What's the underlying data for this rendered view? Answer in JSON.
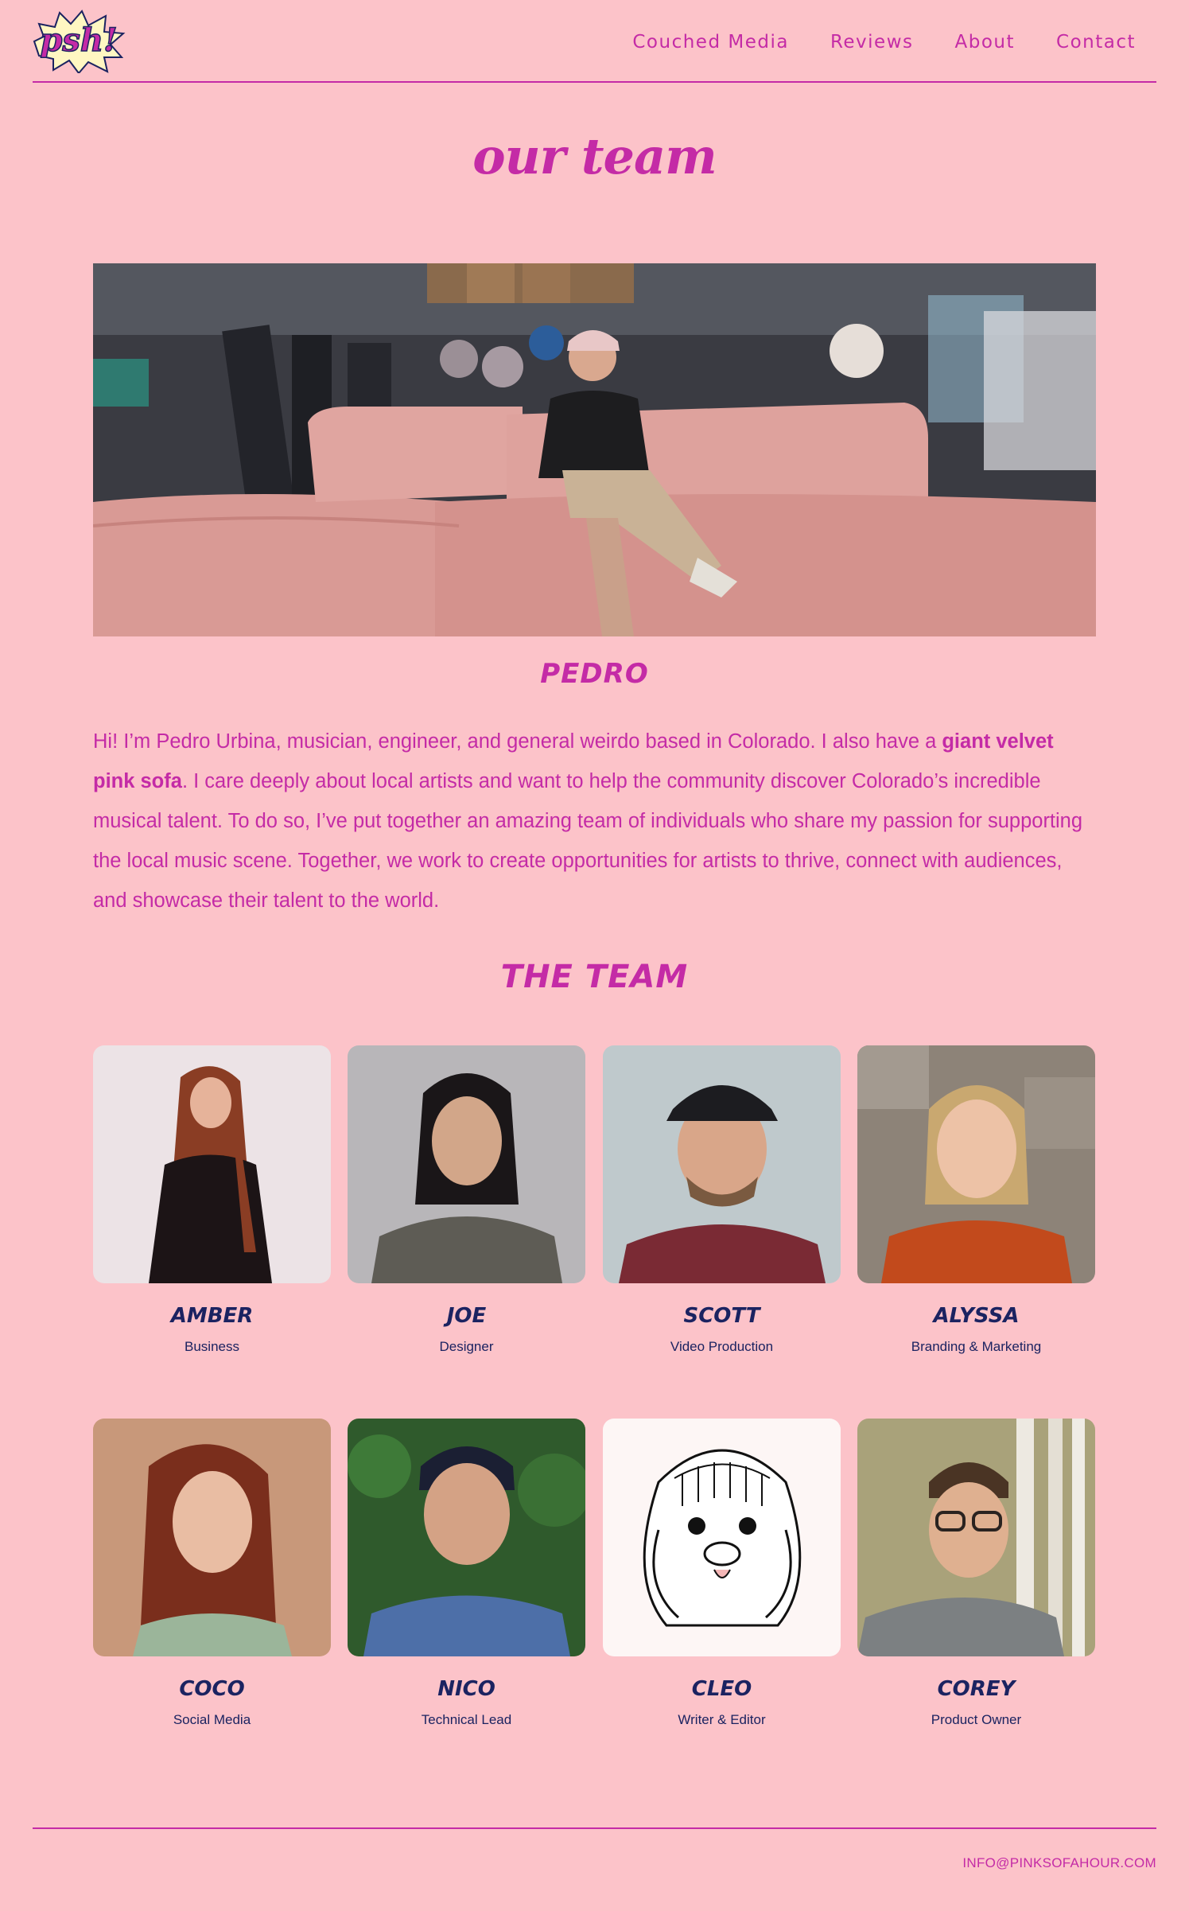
{
  "logo": {
    "text": "psh!"
  },
  "nav": {
    "items": [
      {
        "label": "Couched Media"
      },
      {
        "label": "Reviews"
      },
      {
        "label": "About"
      },
      {
        "label": "Contact"
      }
    ]
  },
  "page": {
    "title": "our team"
  },
  "founder": {
    "name": "PEDRO",
    "bio_before": "Hi! I’m Pedro Urbina, musician, engineer, and general weirdo based in Colorado. I also have a ",
    "bio_bold": "giant velvet pink sofa",
    "bio_after": ". I care deeply about local artists and want to help the community discover Colorado’s incredible musical talent. To do so, I’ve put together an amazing team of individuals who share my passion for supporting the local music scene. Together, we work to create opportunities for artists to thrive, connect with audiences, and showcase their talent to the world."
  },
  "team": {
    "title": "THE TEAM",
    "members": [
      {
        "name": "AMBER",
        "role": "Business"
      },
      {
        "name": "JOE",
        "role": "Designer"
      },
      {
        "name": "SCOTT",
        "role": "Video Production"
      },
      {
        "name": "ALYSSA",
        "role": "Branding & Marketing"
      },
      {
        "name": "COCO",
        "role": "Social Media"
      },
      {
        "name": "NICO",
        "role": "Technical Lead"
      },
      {
        "name": "CLEO",
        "role": "Writer & Editor"
      },
      {
        "name": "COREY",
        "role": "Product Owner"
      }
    ]
  },
  "footer": {
    "email": "INFO@PINKSOFAHOUR.COM"
  },
  "colors": {
    "background": "#fcc3c9",
    "accent": "#c42ba6",
    "navy": "#1b2361"
  }
}
